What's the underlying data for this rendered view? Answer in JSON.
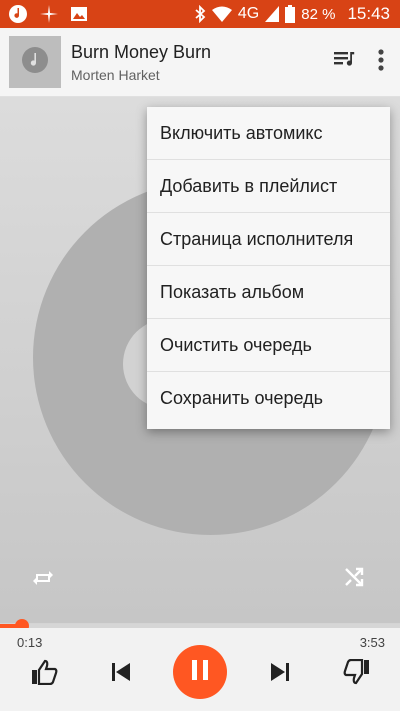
{
  "status_bar": {
    "left_icons": [
      "music-note-icon",
      "sparkle-icon",
      "image-icon"
    ],
    "right_icons": [
      "bluetooth-icon",
      "wifi-icon",
      "signal-icon",
      "battery-icon"
    ],
    "network": "4G",
    "battery": "82 %",
    "time": "15:43",
    "background_color": "#d84315"
  },
  "now_playing": {
    "title": "Burn Money Burn",
    "artist": "Morten Harket",
    "thumbnail_icon": "music-note-icon",
    "queue_icon": "queue-music-icon",
    "more_icon": "more-vert-icon"
  },
  "menu": {
    "items": [
      "Включить автомикс",
      "Добавить в плейлист",
      "Страница исполнителя",
      "Показать альбом",
      "Очистить очередь",
      "Сохранить очередь"
    ]
  },
  "player": {
    "elapsed": "0:13",
    "total": "3:53",
    "progress_fraction": 0.056,
    "accent_color": "#ff5722",
    "controls": [
      "thumb-up-icon",
      "skip-previous-icon",
      "pause-icon",
      "skip-next-icon",
      "thumb-down-icon"
    ],
    "repeat_icon": "repeat-icon",
    "shuffle_icon": "shuffle-icon"
  }
}
